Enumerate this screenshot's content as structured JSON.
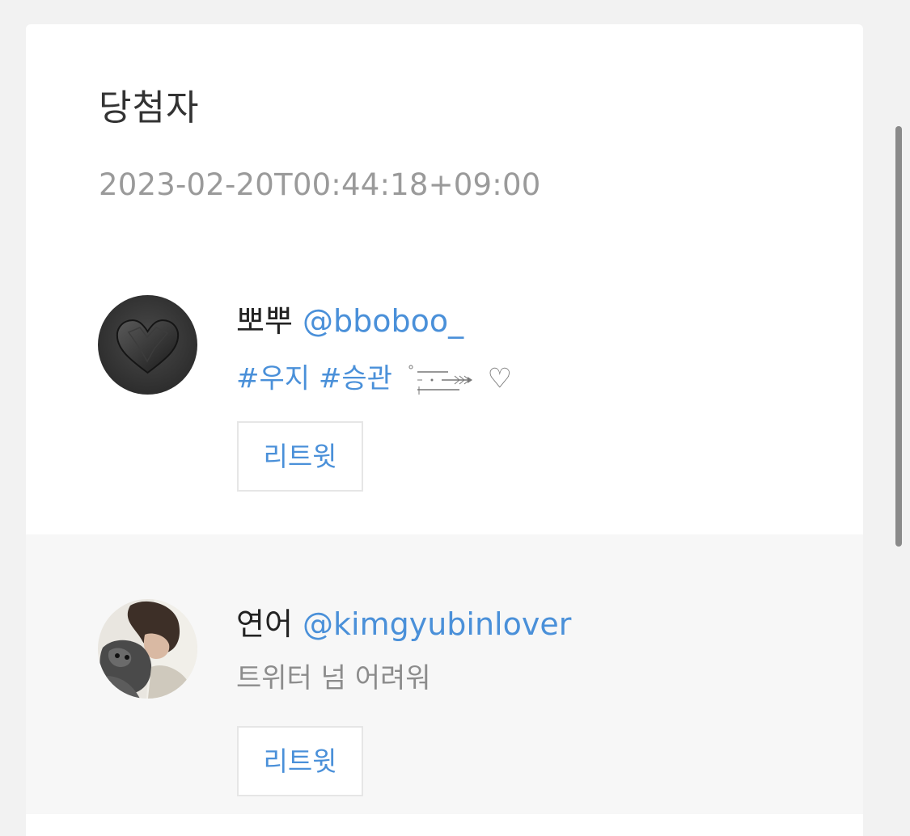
{
  "section": {
    "title": "당첨자",
    "timestamp": "2023-02-20T00:44:18+09:00"
  },
  "winners": [
    {
      "name": "뽀뿌",
      "handle": "@bboboo_",
      "bio_tags": "#우지 #승관",
      "bio_suffix": "♡",
      "avatar_icon": "black-heart-avatar-icon",
      "retweet_label": "리트윗"
    },
    {
      "name": "연어",
      "handle": "@kimgyubinlover",
      "bio": "트위터 넘 어려워",
      "avatar_icon": "person-with-dog-avatar-icon",
      "retweet_label": "리트윗"
    }
  ],
  "colors": {
    "link": "#4a90d9",
    "title": "#333333",
    "muted": "#9a9a9a",
    "alt_row": "#f7f7f7",
    "page_bg": "#f2f2f2"
  }
}
